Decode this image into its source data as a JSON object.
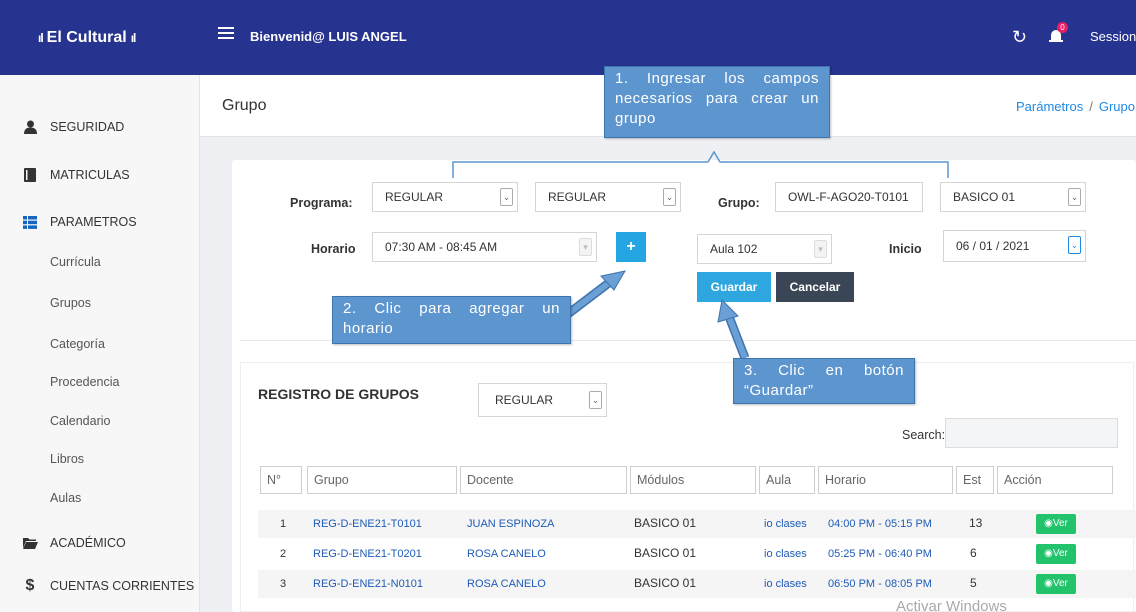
{
  "app": {
    "brand": "El Cultural",
    "welcome": "Bienvenid@ LUIS ANGEL",
    "session": "Session",
    "notifications_count": "0",
    "accent": "#26338f"
  },
  "sidebar": {
    "items": [
      {
        "label": "SEGURIDAD",
        "icon": "user-icon"
      },
      {
        "label": "MATRICULAS",
        "icon": "book-icon"
      },
      {
        "label": "PARAMETROS",
        "icon": "list-icon"
      },
      {
        "label": "ACADÉMICO",
        "icon": "folder-icon"
      },
      {
        "label": "CUENTAS CORRIENTES",
        "icon": "dollar-icon"
      }
    ],
    "subitems": [
      "Currícula",
      "Grupos",
      "Categoría",
      "Procedencia",
      "Calendario",
      "Libros",
      "Aulas"
    ]
  },
  "page": {
    "title": "Grupo",
    "breadcrumb": [
      "Parámetros",
      "Grupo"
    ]
  },
  "form": {
    "programa_label": "Programa:",
    "programa_value": "REGULAR",
    "programa_value2": "REGULAR",
    "grupo_label": "Grupo:",
    "grupo_code": "OWL-F-AGO20-T0101",
    "grupo_level": "BASICO 01",
    "horario_label": "Horario",
    "horario_value": "07:30 AM - 08:45 AM",
    "add_button": "+",
    "aula_value": "Aula 102",
    "inicio_label": "Inicio",
    "inicio_value": "06 / 01 / 2021",
    "save_button": "Guardar",
    "cancel_button": "Cancelar"
  },
  "callouts": {
    "c1": "1. Ingresar los campos necesarios para crear un grupo",
    "c2": "2. Clic para agregar un horario",
    "c3": "3. Clic en botón “Guardar”"
  },
  "registro": {
    "title": "REGISTRO DE GRUPOS",
    "filter_value": "REGULAR",
    "search_label": "Search:",
    "columns": [
      "N°",
      "Grupo",
      "Docente",
      "Módulos",
      "Aula",
      "Horario",
      "Est",
      "Acción"
    ],
    "rows": [
      {
        "n": "1",
        "grupo": "REG-D-ENE21-T0101",
        "docente": "JUAN ESPINOZA",
        "modulo": "BASICO 01",
        "aula": "io clases",
        "horario": "04:00 PM - 05:15 PM",
        "est": "13",
        "accion": "Ver"
      },
      {
        "n": "2",
        "grupo": "REG-D-ENE21-T0201",
        "docente": "ROSA CANELO",
        "modulo": "BASICO 01",
        "aula": "io clases",
        "horario": "05:25 PM - 06:40 PM",
        "est": "6",
        "accion": "Ver"
      },
      {
        "n": "3",
        "grupo": "REG-D-ENE21-N0101",
        "docente": "ROSA CANELO",
        "modulo": "BASICO 01",
        "aula": "io clases",
        "horario": "06:50 PM - 08:05 PM",
        "est": "5",
        "accion": "Ver"
      }
    ]
  },
  "watermark": "Activar Windows"
}
